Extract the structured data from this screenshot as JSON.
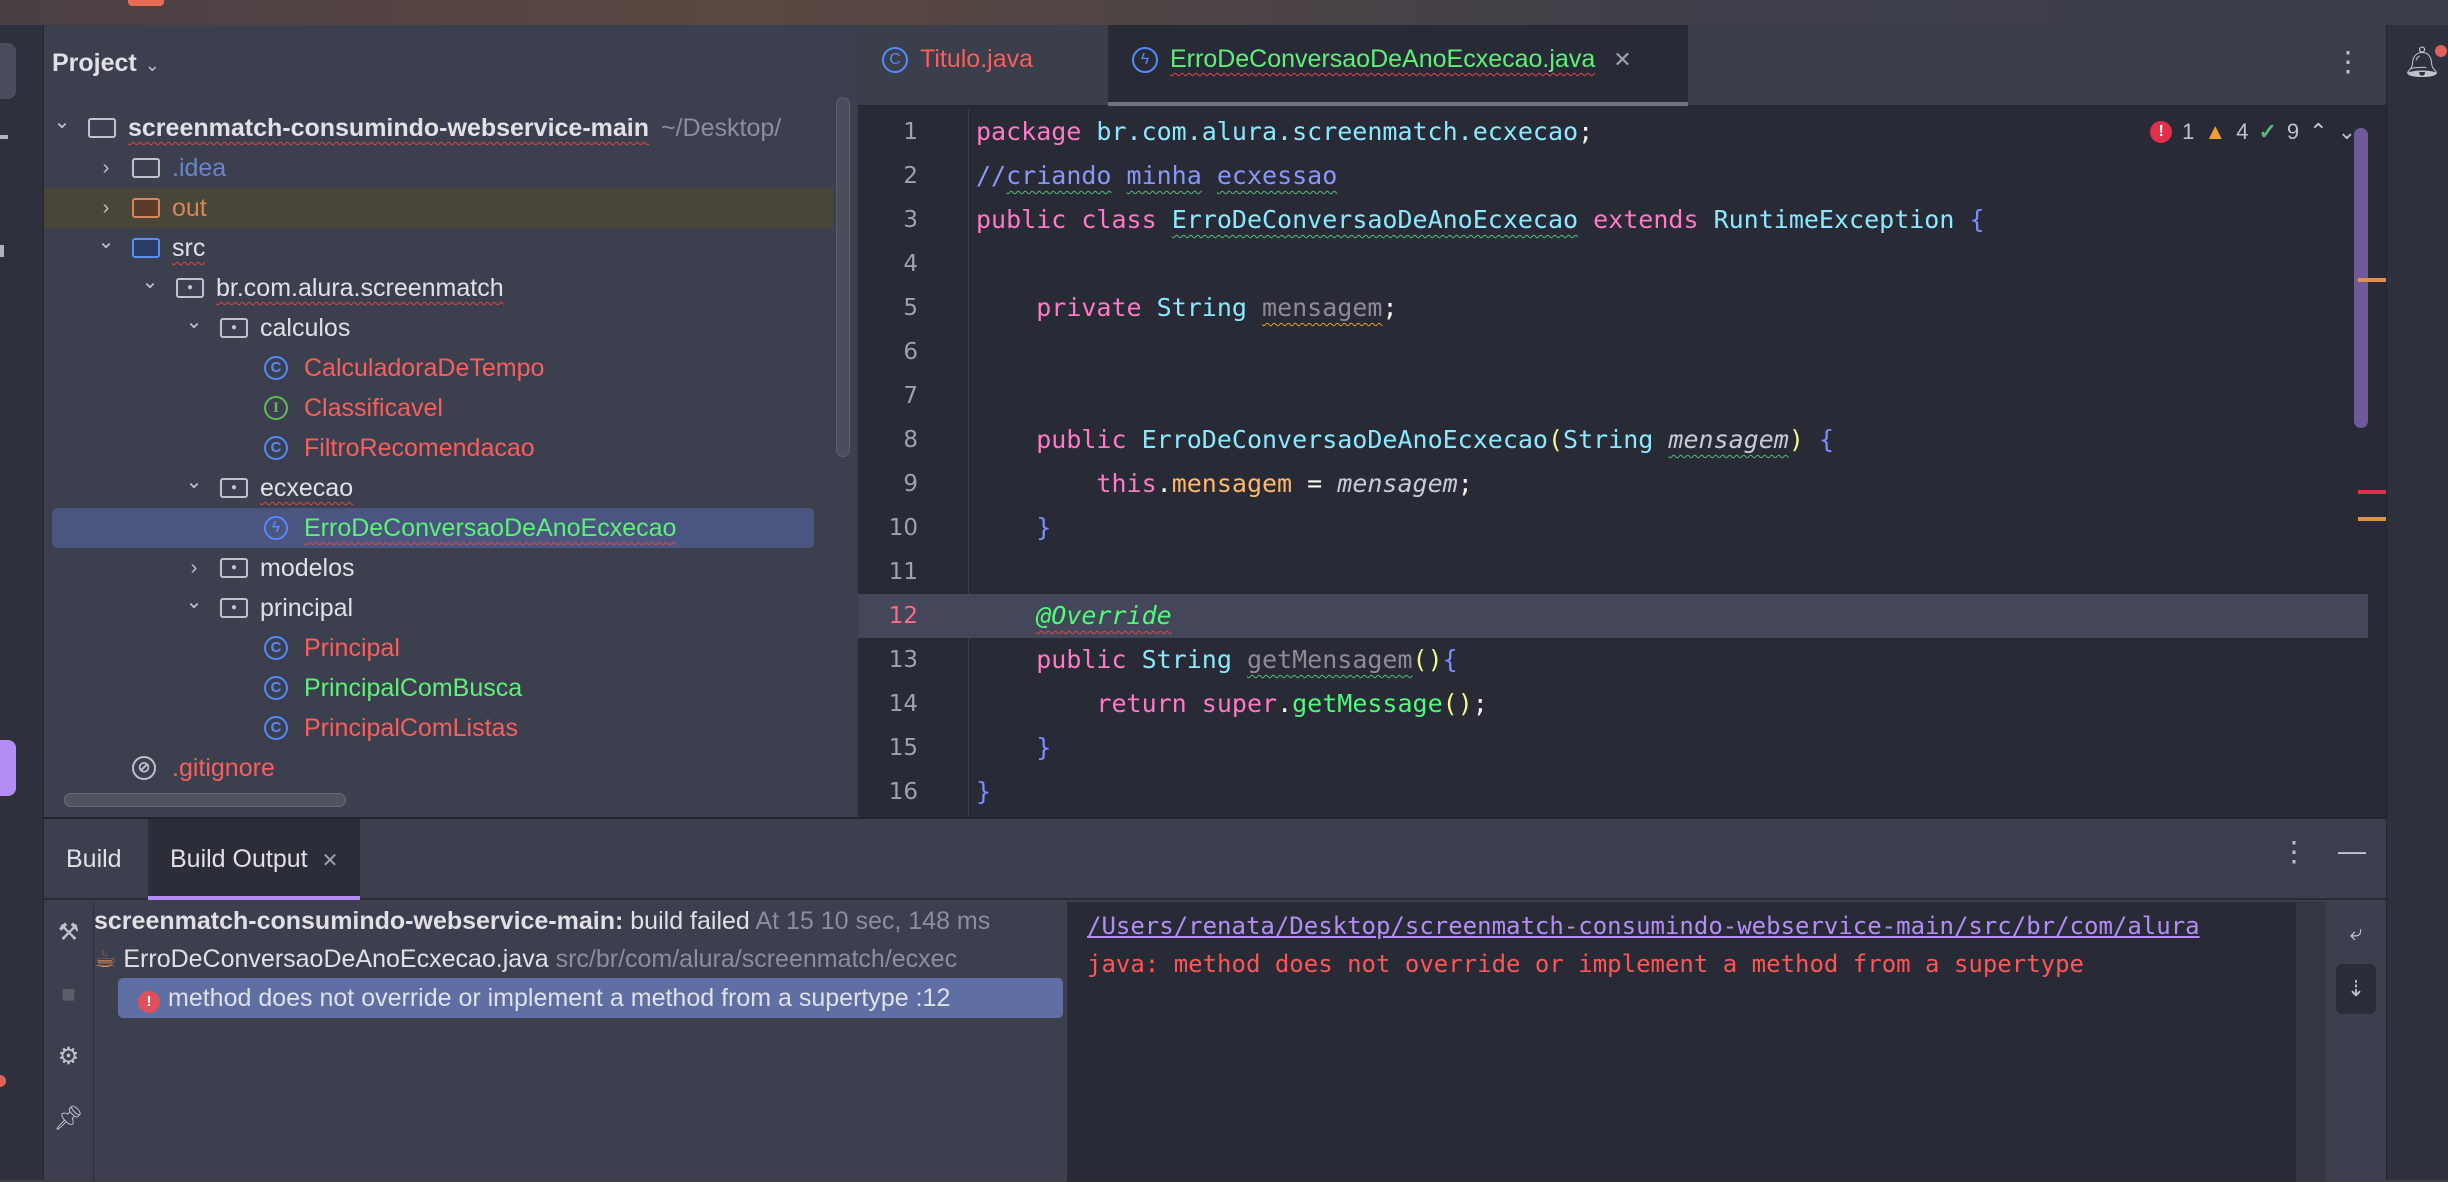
{
  "project": {
    "title": "Project",
    "tree": [
      {
        "label": "screenmatch-consumindo-webservice-main",
        "suffix": "~/Desktop/",
        "icon": "module-folder-icon",
        "depth": 0,
        "chevron": "down",
        "color": "def",
        "bold": true,
        "squiggle": true
      },
      {
        "label": ".idea",
        "icon": "folder-icon",
        "depth": 1,
        "chevron": "right",
        "color": "blue"
      },
      {
        "label": "out",
        "icon": "folder-excluded-icon",
        "depth": 1,
        "chevron": "right",
        "color": "orange",
        "highlight": "out"
      },
      {
        "label": "src",
        "icon": "source-folder-icon",
        "depth": 1,
        "chevron": "down",
        "color": "def",
        "squiggle": true
      },
      {
        "label": "br.com.alura.screenmatch",
        "icon": "package-icon",
        "depth": 2,
        "chevron": "down",
        "color": "def",
        "squiggle": true
      },
      {
        "label": "calculos",
        "icon": "package-icon",
        "depth": 3,
        "chevron": "down",
        "color": "def"
      },
      {
        "label": "CalculadoraDeTempo",
        "icon": "class-icon",
        "depth": 4,
        "color": "red"
      },
      {
        "label": "Classificavel",
        "icon": "interface-icon",
        "depth": 4,
        "color": "red"
      },
      {
        "label": "FiltroRecomendacao",
        "icon": "class-icon",
        "depth": 4,
        "color": "red"
      },
      {
        "label": "ecxecao",
        "icon": "package-icon",
        "depth": 3,
        "chevron": "down",
        "color": "def",
        "squiggle": true
      },
      {
        "label": "ErroDeConversaoDeAnoEcxecao",
        "icon": "exception-class-icon",
        "depth": 4,
        "color": "green",
        "squiggle": true,
        "selected": true
      },
      {
        "label": "modelos",
        "icon": "package-icon",
        "depth": 3,
        "chevron": "right",
        "color": "def"
      },
      {
        "label": "principal",
        "icon": "package-icon",
        "depth": 3,
        "chevron": "down",
        "color": "def"
      },
      {
        "label": "Principal",
        "icon": "class-icon",
        "depth": 4,
        "color": "red"
      },
      {
        "label": "PrincipalComBusca",
        "icon": "class-icon",
        "depth": 4,
        "color": "green"
      },
      {
        "label": "PrincipalComListas",
        "icon": "class-icon",
        "depth": 4,
        "color": "red"
      },
      {
        "label": ".gitignore",
        "icon": "ignored-file-icon",
        "depth": 1,
        "color": "red"
      }
    ]
  },
  "editor": {
    "tabs": [
      {
        "label": "Titulo.java",
        "icon": "class-icon",
        "active": false,
        "color": "#f75f5f"
      },
      {
        "label": "ErroDeConversaoDeAnoEcxecao.java",
        "icon": "exception-class-icon",
        "active": true,
        "color": "#5ff07a"
      }
    ],
    "inspections": {
      "errors": "1",
      "warnings": "4",
      "ok": "9"
    },
    "current_line": 12,
    "lines": [
      [
        [
          "package",
          "kw"
        ],
        [
          " ",
          ""
        ],
        [
          "br.com.alura.screenmatch.ecxecao",
          "ty"
        ],
        [
          ";",
          "pl"
        ]
      ],
      [
        [
          "//",
          "cm"
        ],
        [
          "criando",
          "cm sq"
        ],
        [
          " ",
          "cm"
        ],
        [
          "minha",
          "cm sq"
        ],
        [
          " ",
          "cm"
        ],
        [
          "ecxessao",
          "cm sq"
        ]
      ],
      [
        [
          "public",
          "kw"
        ],
        [
          " ",
          ""
        ],
        [
          "class",
          "kw"
        ],
        [
          " ",
          ""
        ],
        [
          "ErroDeConversaoDeAnoEcxecao",
          "ty sq"
        ],
        [
          " ",
          ""
        ],
        [
          "extends",
          "kw"
        ],
        [
          " ",
          ""
        ],
        [
          "RuntimeException",
          "ty"
        ],
        [
          " ",
          ""
        ],
        [
          "{",
          "br"
        ]
      ],
      [],
      [
        [
          "    ",
          ""
        ],
        [
          "private",
          "kw"
        ],
        [
          " ",
          ""
        ],
        [
          "String",
          "ty"
        ],
        [
          " ",
          ""
        ],
        [
          "mensagem",
          "fg sqo"
        ],
        [
          ";",
          "pl"
        ]
      ],
      [],
      [],
      [
        [
          "    ",
          ""
        ],
        [
          "public",
          "kw"
        ],
        [
          " ",
          ""
        ],
        [
          "ErroDeConversaoDeAnoEcxecao",
          "ty"
        ],
        [
          "(",
          "pa"
        ],
        [
          "String",
          "ty"
        ],
        [
          " ",
          ""
        ],
        [
          "mensagem",
          "it sq"
        ],
        [
          ")",
          "pa"
        ],
        [
          " ",
          ""
        ],
        [
          "{",
          "br"
        ]
      ],
      [
        [
          "        ",
          ""
        ],
        [
          "this",
          "kw"
        ],
        [
          ".",
          "pl"
        ],
        [
          "mensagem",
          "fo"
        ],
        [
          " = ",
          "pl"
        ],
        [
          "mensagem",
          "it"
        ],
        [
          ";",
          "pl"
        ]
      ],
      [
        [
          "    ",
          ""
        ],
        [
          "}",
          "br"
        ]
      ],
      [],
      [
        [
          "    ",
          ""
        ],
        [
          "@Override",
          "an sqr"
        ]
      ],
      [
        [
          "    ",
          ""
        ],
        [
          "public",
          "kw"
        ],
        [
          " ",
          ""
        ],
        [
          "String",
          "ty"
        ],
        [
          " ",
          ""
        ],
        [
          "getMensagem",
          "fg sq"
        ],
        [
          "()",
          "pa"
        ],
        [
          "{",
          "br"
        ]
      ],
      [
        [
          "        ",
          ""
        ],
        [
          "return",
          "kw"
        ],
        [
          " ",
          ""
        ],
        [
          "super",
          "kw"
        ],
        [
          ".",
          "pl"
        ],
        [
          "getMessage",
          "fn"
        ],
        [
          "()",
          "pa"
        ],
        [
          ";",
          "pl"
        ]
      ],
      [
        [
          "    ",
          ""
        ],
        [
          "}",
          "br"
        ]
      ],
      [
        [
          "}",
          "br"
        ]
      ]
    ]
  },
  "build": {
    "tabs": [
      {
        "label": "Build"
      },
      {
        "label": "Build Output",
        "active": true
      }
    ],
    "tree": {
      "root_label": "screenmatch-consumindo-webservice-main:",
      "root_status": "build failed",
      "root_time": "At 15 10 sec, 148 ms",
      "file_label": "ErroDeConversaoDeAnoEcxecao.java",
      "file_path": "src/br/com/alura/screenmatch/ecxec",
      "error_label": "method does not override or implement a method from a supertype :12"
    },
    "console": {
      "path_link": "/Users/renata/Desktop/screenmatch-consumindo-webservice-main/src/br/com/alura",
      "error_text": "java: method does not override or implement a method from a supertype"
    }
  }
}
